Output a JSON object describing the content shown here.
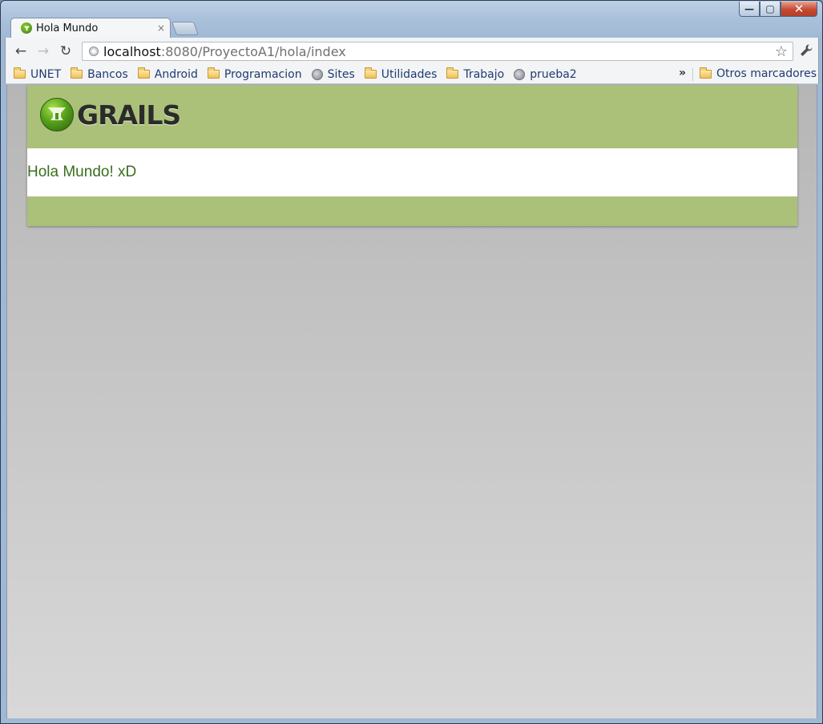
{
  "window": {
    "background_tabs": [
      "",
      "",
      "",
      "",
      "",
      ""
    ],
    "controls": {
      "minimize": "—",
      "maximize": "▢",
      "close": "✕"
    }
  },
  "tab": {
    "title": "Hola Mundo",
    "close": "×",
    "favicon": "grails-icon"
  },
  "toolbar": {
    "back": "←",
    "forward": "→",
    "reload": "↻",
    "url_host": "localhost",
    "url_rest": ":8080/ProyectoA1/hola/index",
    "star": "☆",
    "wrench": "🔧"
  },
  "bookmarks": {
    "items": [
      {
        "label": "UNET",
        "icon": "folder-icon"
      },
      {
        "label": "Bancos",
        "icon": "folder-icon"
      },
      {
        "label": "Android",
        "icon": "folder-icon"
      },
      {
        "label": "Programacion",
        "icon": "folder-icon"
      },
      {
        "label": "Sites",
        "icon": "site-icon"
      },
      {
        "label": "Utilidades",
        "icon": "folder-icon"
      },
      {
        "label": "Trabajo",
        "icon": "folder-icon"
      },
      {
        "label": "prueba2",
        "icon": "site-icon"
      }
    ],
    "overflow": "»",
    "other": "Otros marcadores"
  },
  "page": {
    "logo_text": "GRAILS",
    "message": "Hola Mundo! xD",
    "colors": {
      "header": "#abc17a",
      "message": "#3a6e1d"
    }
  }
}
